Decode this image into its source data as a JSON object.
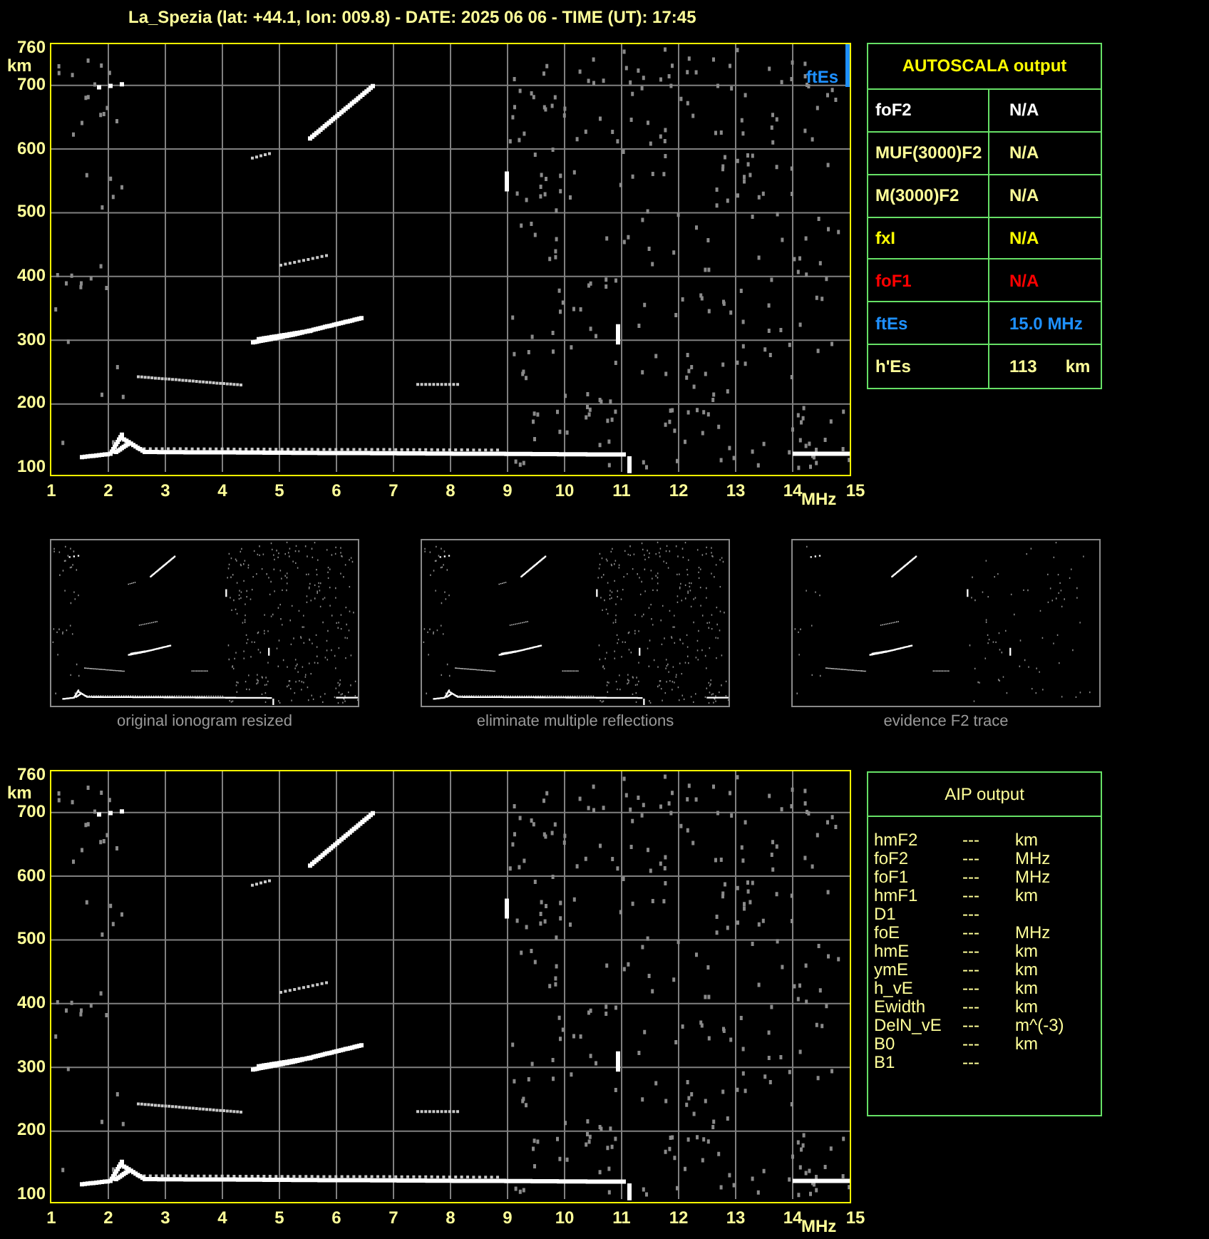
{
  "title": "La_Spezia (lat: +44.1, lon: 009.8) - DATE: 2025 06 06 - TIME (UT): 17:45",
  "ionograms": [
    {
      "y_ticks": [
        "760",
        "700",
        "600",
        "500",
        "400",
        "300",
        "200",
        "100"
      ],
      "y_unit": "km",
      "x_ticks": [
        "1",
        "2",
        "3",
        "4",
        "5",
        "6",
        "7",
        "8",
        "9",
        "10",
        "11",
        "12",
        "13",
        "14",
        "15"
      ],
      "x_unit": "MHz",
      "marker": {
        "label": "ftEs"
      }
    },
    {
      "y_ticks": [
        "760",
        "700",
        "600",
        "500",
        "400",
        "300",
        "200",
        "100"
      ],
      "y_unit": "km",
      "x_ticks": [
        "1",
        "2",
        "3",
        "4",
        "5",
        "6",
        "7",
        "8",
        "9",
        "10",
        "11",
        "12",
        "13",
        "14",
        "15"
      ],
      "x_unit": "MHz"
    }
  ],
  "autoscala": {
    "title": "AUTOSCALA output",
    "rows": [
      {
        "name": "foF2",
        "value": "N/A",
        "color": "#ffffff"
      },
      {
        "name": "MUF(3000)F2",
        "value": "N/A",
        "color": "#ffff99"
      },
      {
        "name": "M(3000)F2",
        "value": "N/A",
        "color": "#ffff99"
      },
      {
        "name": "fxI",
        "value": "N/A",
        "color": "#ffff00"
      },
      {
        "name": "foF1",
        "value": "N/A",
        "color": "#ff0000"
      },
      {
        "name": "ftEs",
        "value": "15.0 MHz",
        "color": "#1e90ff"
      },
      {
        "name": "h'Es",
        "value": "113",
        "unit": "km",
        "color": "#ffff99"
      }
    ]
  },
  "thumbnails": [
    {
      "kind": "original",
      "caption": "original ionogram resized"
    },
    {
      "kind": "filtered",
      "caption": "eliminate multiple reflections"
    },
    {
      "kind": "f2",
      "caption": "evidence F2 trace"
    }
  ],
  "aip": {
    "title": "AIP output",
    "rows": [
      {
        "name": "hmF2",
        "value": "---",
        "unit": "km"
      },
      {
        "name": "foF2",
        "value": "---",
        "unit": "MHz"
      },
      {
        "name": "foF1",
        "value": "---",
        "unit": "MHz"
      },
      {
        "name": "hmF1",
        "value": "---",
        "unit": "km"
      },
      {
        "name": "D1",
        "value": "---"
      },
      {
        "name": "foE",
        "value": "---",
        "unit": "MHz"
      },
      {
        "name": "hmE",
        "value": "---",
        "unit": "km"
      },
      {
        "name": "ymE",
        "value": "---",
        "unit": "km"
      },
      {
        "name": "h_vE",
        "value": "---",
        "unit": "km"
      },
      {
        "name": "Ewidth",
        "value": "---",
        "unit": "km"
      },
      {
        "name": "DelN_vE",
        "value": "---",
        "unit": "m^(-3)"
      },
      {
        "name": "B0",
        "value": "---",
        "unit": "km"
      },
      {
        "name": "B1",
        "value": "---"
      }
    ]
  }
}
